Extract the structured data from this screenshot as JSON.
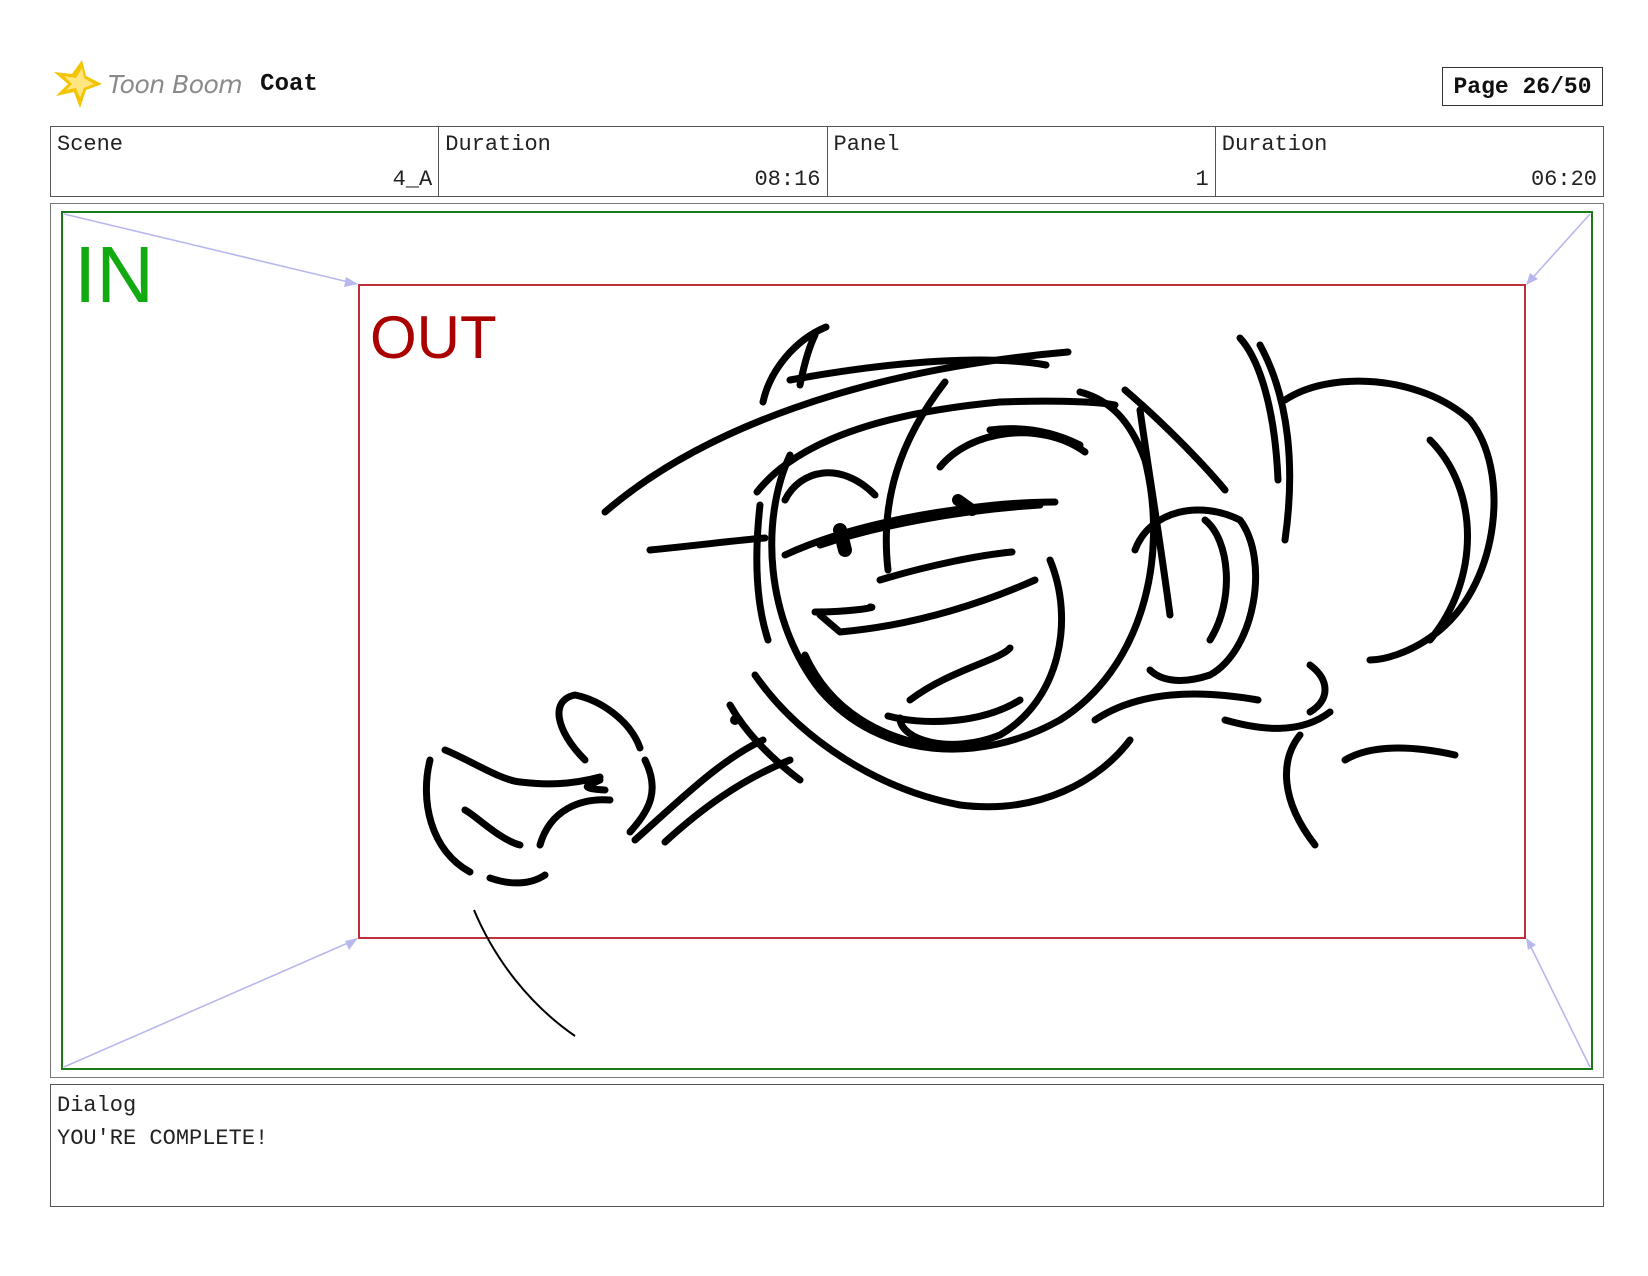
{
  "header": {
    "logo_text": "Toon Boom",
    "project_title": "Coat",
    "page_indicator": "Page 26/50"
  },
  "info": {
    "scene_label": "Scene",
    "scene_value": "4_A",
    "scene_duration_label": "Duration",
    "scene_duration_value": "08:16",
    "panel_label": "Panel",
    "panel_value": "1",
    "panel_duration_label": "Duration",
    "panel_duration_value": "06:20"
  },
  "panel": {
    "in_label": "IN",
    "out_label": "OUT",
    "in_color": "#11aa11",
    "out_color": "#aa0000",
    "in_frame_color": "#1a7a1a",
    "out_frame_color": "#c0303a",
    "guide_color": "#b8b8ee"
  },
  "dialog": {
    "label": "Dialog",
    "text": "YOU'RE COMPLETE!"
  },
  "colors": {
    "logo_star": "#f5c400",
    "logo_text": "#8a8a8a"
  }
}
